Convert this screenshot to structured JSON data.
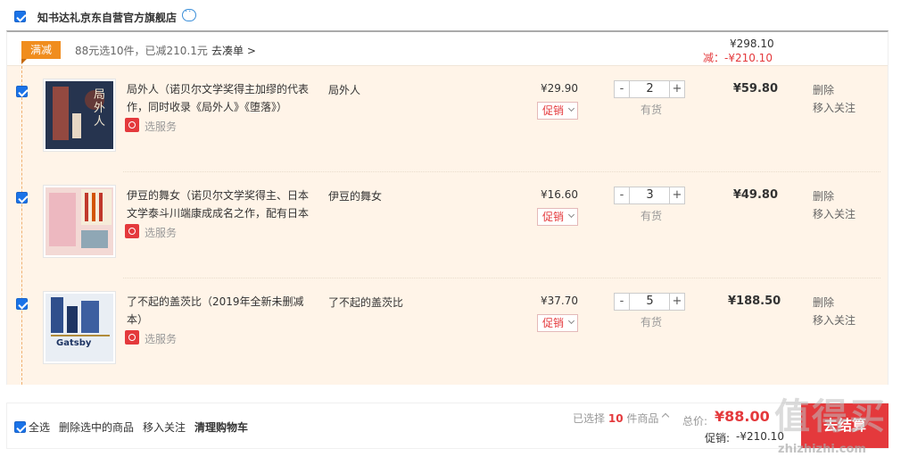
{
  "shop": {
    "name": "知书达礼京东自营官方旗舰店"
  },
  "promo": {
    "tag": "满减",
    "text": "88元选10件，已减210.1元",
    "link": "去凑单 >",
    "total": "¥298.10",
    "minus": "减：-¥210.10"
  },
  "items": [
    {
      "title": "局外人（诺贝尔文学奖得主加缪的代表作，同时收录《局外人》《堕落》）",
      "service": "选服务",
      "prop": "局外人",
      "price": "¥29.90",
      "promo": "促销",
      "qty_minus": "-",
      "qty": "2",
      "qty_plus": "+",
      "stock": "有货",
      "subtotal": "¥59.80",
      "delete": "删除",
      "favorite": "移入关注",
      "cover_title": "局外人"
    },
    {
      "title": "伊豆的舞女（诺贝尔文学奖得主、日本文学泰斗川端康成成名之作，配有日本",
      "service": "选服务",
      "prop": "伊豆的舞女",
      "price": "¥16.60",
      "promo": "促销",
      "qty_minus": "-",
      "qty": "3",
      "qty_plus": "+",
      "stock": "有货",
      "subtotal": "¥49.80",
      "delete": "删除",
      "favorite": "移入关注",
      "cover_title": ""
    },
    {
      "title": "了不起的盖茨比（2019年全新未删减本）",
      "service": "选服务",
      "prop": "了不起的盖茨比",
      "price": "¥37.70",
      "promo": "促销",
      "qty_minus": "-",
      "qty": "5",
      "qty_plus": "+",
      "stock": "有货",
      "subtotal": "¥188.50",
      "delete": "删除",
      "favorite": "移入关注",
      "cover_title": "Gatsby"
    }
  ],
  "footer": {
    "select_all": "全选",
    "delete_selected": "删除选中的商品",
    "move_favorites": "移入关注",
    "clear_cart": "清理购物车",
    "selected_prefix": "已选择",
    "selected_count": "10",
    "selected_suffix": "件商品",
    "total_label": "总价:",
    "total_value": "¥88.00",
    "discount_label": "促销:",
    "discount_value": "-¥210.10",
    "checkout": "去结算"
  },
  "watermark": {
    "text": "值得买",
    "url": "zhizhizhi.com"
  },
  "colors": {
    "accent": "#e4393c",
    "promo_tag": "#f08d1e",
    "item_bg": "#fff4e8",
    "checkbox": "#1a73e8"
  }
}
